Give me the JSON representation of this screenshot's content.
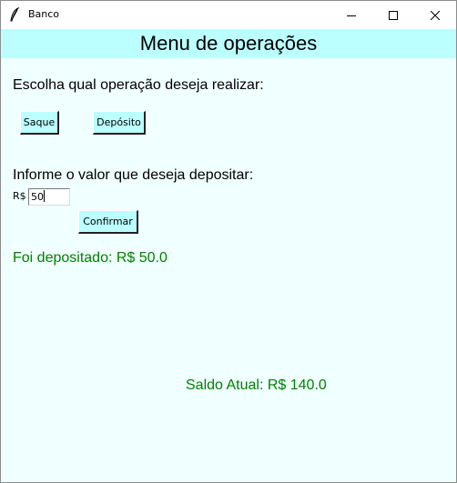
{
  "window": {
    "title": "Banco",
    "icons": {
      "app": "feather-icon",
      "minimize": "minimize-icon",
      "maximize": "maximize-icon",
      "close": "close-icon"
    }
  },
  "header": {
    "title": "Menu de operações"
  },
  "menu": {
    "prompt": "Escolha qual operação deseja realizar:",
    "saque_label": "Saque",
    "deposito_label": "Depósito"
  },
  "deposit": {
    "prompt": "Informe o valor que deseja depositar:",
    "currency_label": "R$",
    "amount_value": "50",
    "confirm_label": "Confirmar",
    "result_text": "Foi depositado: R$ 50.0"
  },
  "balance": {
    "text": "Saldo Atual: R$ 140.0"
  },
  "colors": {
    "background": "#f0ffff",
    "header_background": "#bbffff",
    "button_background": "#bbffff",
    "success_text": "#008000"
  }
}
